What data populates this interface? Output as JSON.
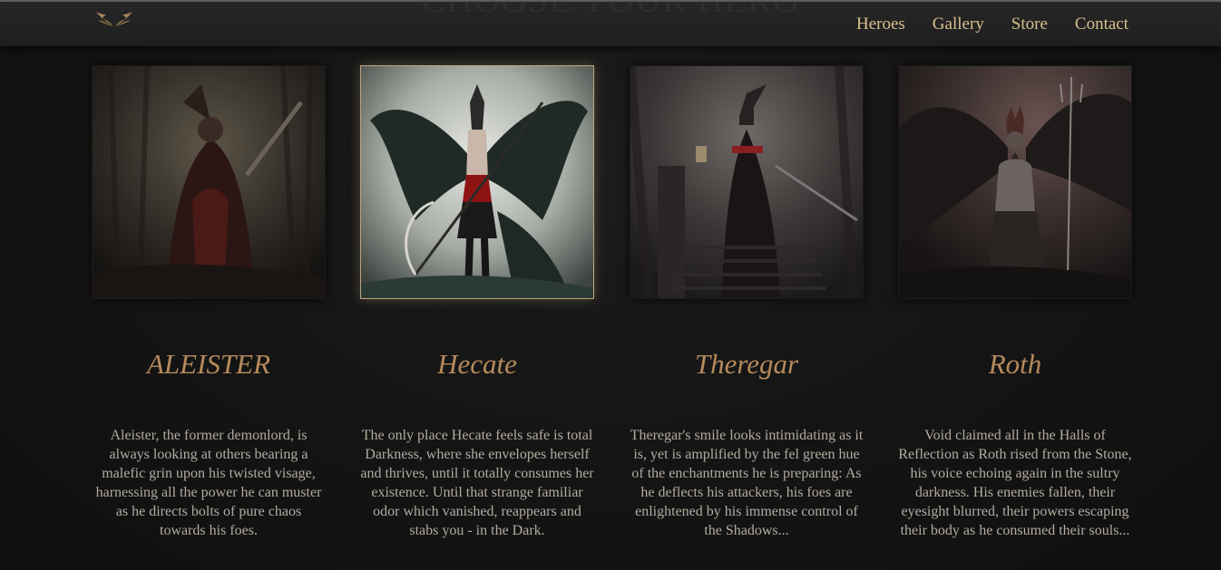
{
  "page": {
    "ghost_title": "CHOOSE YOUR HERO"
  },
  "nav": {
    "logo": "winged-logo-icon",
    "links": [
      "Heroes",
      "Gallery",
      "Store",
      "Contact"
    ]
  },
  "colors": {
    "accent": "#d6c08f",
    "hero_name": "#b68a5c",
    "text": "#b3aca0",
    "background": "#141414"
  },
  "heroes": [
    {
      "name": "ALEISTER",
      "description": "Aleister, the former demonlord, is always looking at others bearing a malefic grin upon his twisted visage, harnessing all the power he can muster as he directs bolts of pure chaos towards his foes.",
      "active": false
    },
    {
      "name": "Hecate",
      "description": "The only place Hecate feels safe is total Darkness, where she envelopes herself and thrives, until it totally consumes her existence. Until that strange familiar odor which vanished, reappears and stabs you - in the Dark.",
      "active": true
    },
    {
      "name": "Theregar",
      "description": "Theregar's smile looks intimidating as it is, yet is amplified by the fel green hue of the enchantments he is preparing: As he deflects his attackers, his foes are enlightened by his immense control of the Shadows...",
      "active": false
    },
    {
      "name": "Roth",
      "description": "Void claimed all in the Halls of Reflection as Roth rised from the Stone, his voice echoing again in the sultry darkness. His enemies fallen, their eyesight blurred, their powers escaping their body as he consumed their souls...",
      "active": false
    }
  ]
}
